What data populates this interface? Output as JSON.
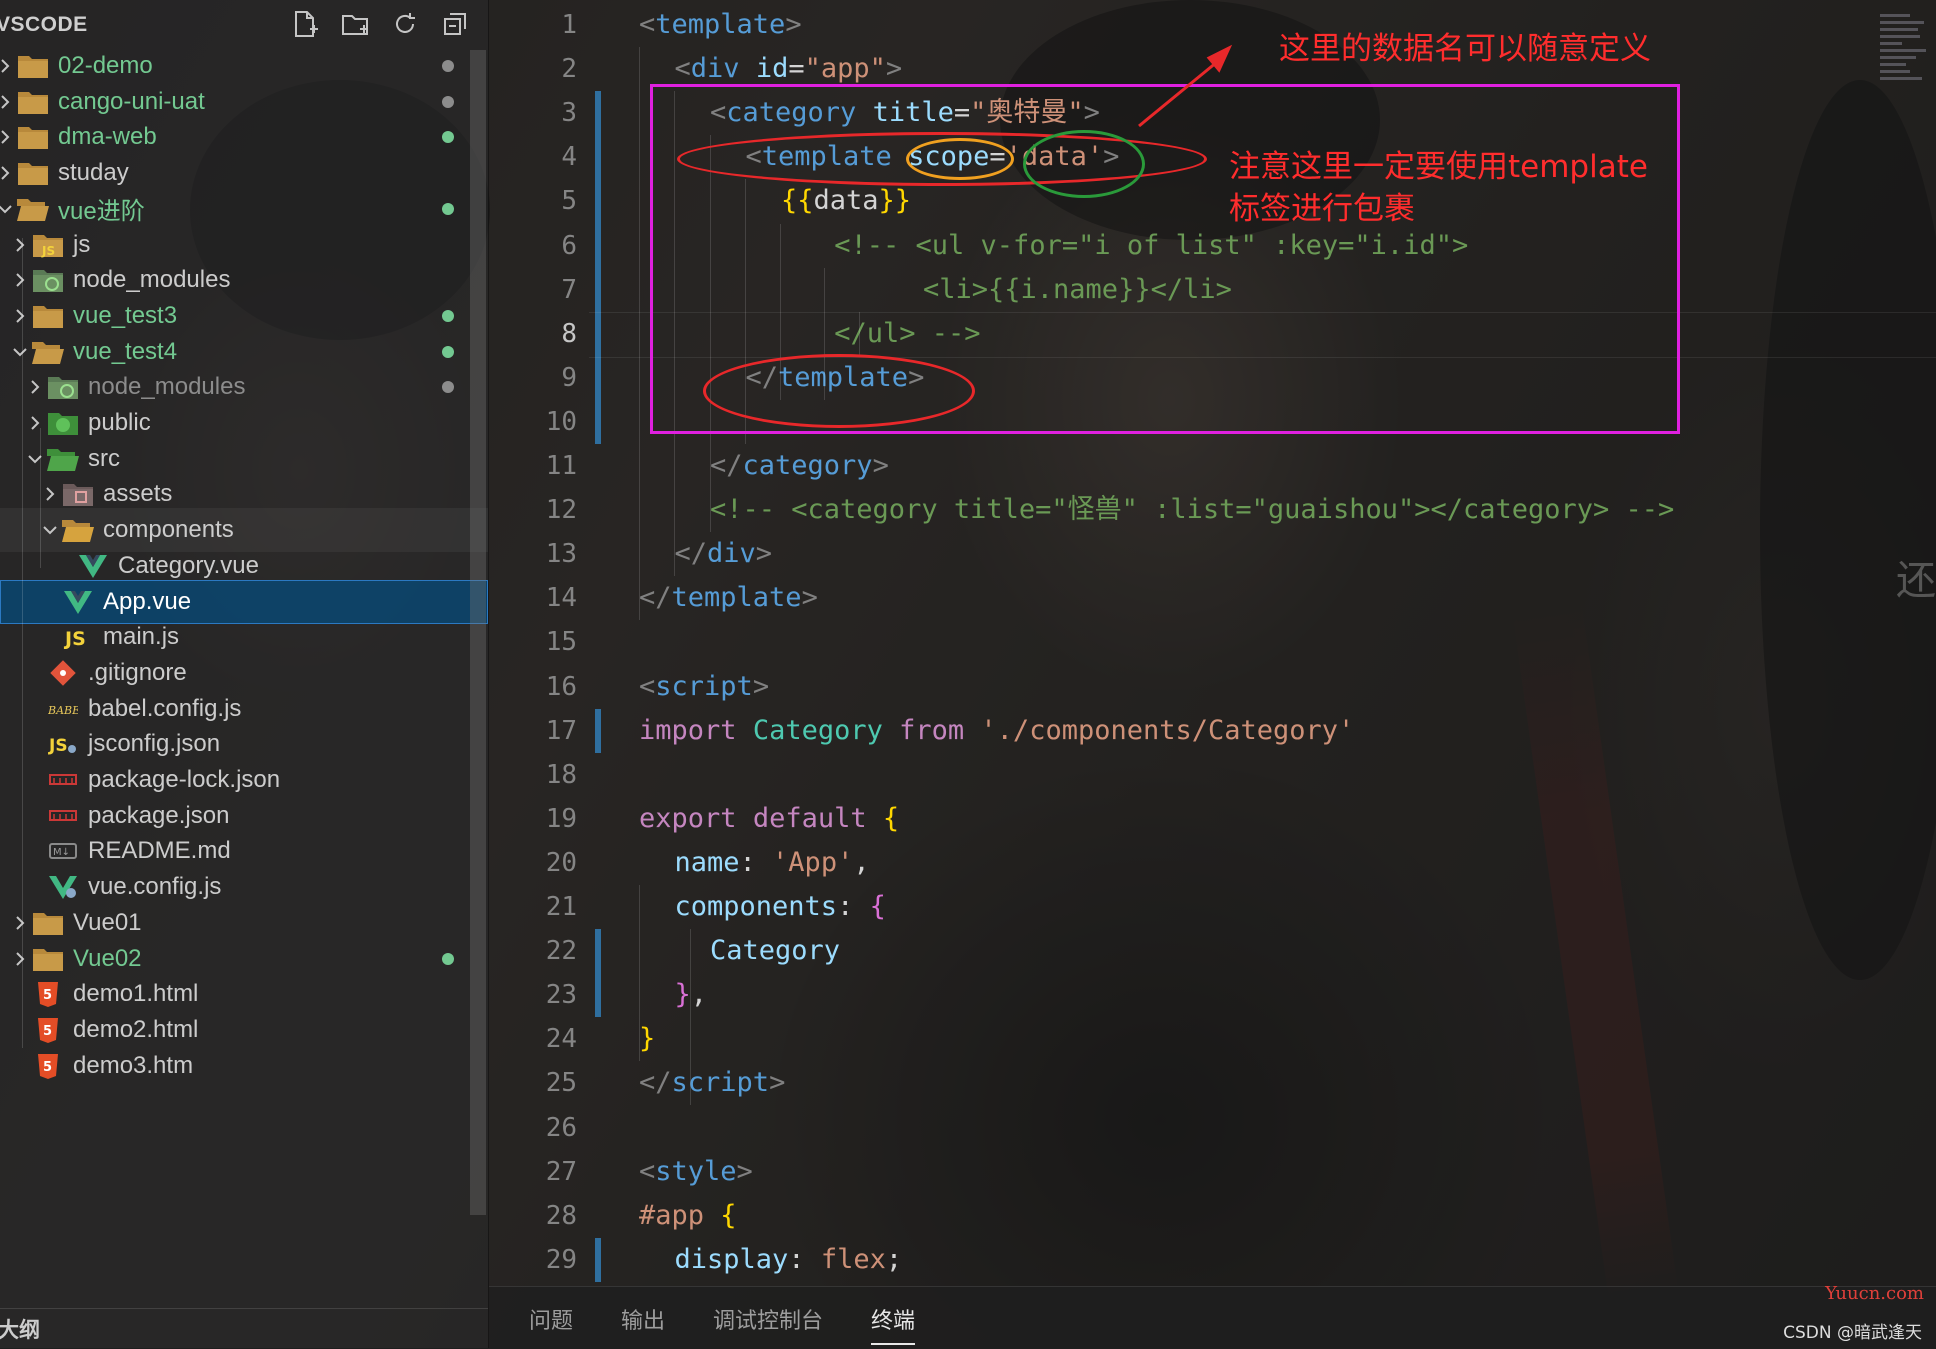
{
  "sidebar": {
    "title": "VSCODE",
    "actions": [
      "new-file-icon",
      "new-folder-icon",
      "refresh-icon",
      "collapse-all-icon"
    ],
    "outline_title": "大纲"
  },
  "tree": [
    {
      "label": "02-demo",
      "type": "folder",
      "depth": 0,
      "expanded": false,
      "color": "#73c991",
      "dot": "#8c8c8c"
    },
    {
      "label": "cango-uni-uat",
      "type": "folder",
      "depth": 0,
      "expanded": false,
      "color": "#73c991",
      "dot": "#8c8c8c"
    },
    {
      "label": "dma-web",
      "type": "folder",
      "depth": 0,
      "expanded": false,
      "color": "#73c991",
      "dot": "#73c991"
    },
    {
      "label": "studay",
      "type": "folder",
      "depth": 0,
      "expanded": false,
      "color": "#cccccc",
      "dot": ""
    },
    {
      "label": "vue进阶",
      "type": "folder-open",
      "depth": 0,
      "expanded": true,
      "color": "#73c991",
      "dot": "#73c991"
    },
    {
      "label": "js",
      "type": "folder-js",
      "depth": 1,
      "expanded": false,
      "color": "#cccccc",
      "dot": ""
    },
    {
      "label": "node_modules",
      "type": "folder-node",
      "depth": 1,
      "expanded": false,
      "color": "#cccccc",
      "dot": ""
    },
    {
      "label": "vue_test3",
      "type": "folder",
      "depth": 1,
      "expanded": false,
      "color": "#73c991",
      "dot": "#73c991"
    },
    {
      "label": "vue_test4",
      "type": "folder-open",
      "depth": 1,
      "expanded": true,
      "color": "#73c991",
      "dot": "#73c991"
    },
    {
      "label": "node_modules",
      "type": "folder-node",
      "depth": 2,
      "expanded": false,
      "color": "#8c8c8c",
      "dot": "#8c8c8c"
    },
    {
      "label": "public",
      "type": "folder-public",
      "depth": 2,
      "expanded": false,
      "color": "#cccccc",
      "dot": ""
    },
    {
      "label": "src",
      "type": "folder-src",
      "depth": 2,
      "expanded": true,
      "color": "#cccccc",
      "dot": ""
    },
    {
      "label": "assets",
      "type": "folder-assets",
      "depth": 3,
      "expanded": false,
      "color": "#cccccc",
      "dot": ""
    },
    {
      "label": "components",
      "type": "folder-components",
      "depth": 3,
      "expanded": true,
      "color": "#cccccc",
      "dot": "",
      "hover": true
    },
    {
      "label": "Category.vue",
      "type": "vue",
      "depth": 4,
      "color": "#cccccc",
      "dot": ""
    },
    {
      "label": "App.vue",
      "type": "vue",
      "depth": 3,
      "color": "#ffffff",
      "dot": "",
      "selected": true
    },
    {
      "label": "main.js",
      "type": "js",
      "depth": 3,
      "color": "#cccccc",
      "dot": ""
    },
    {
      "label": ".gitignore",
      "type": "git",
      "depth": 2,
      "color": "#cccccc",
      "dot": ""
    },
    {
      "label": "babel.config.js",
      "type": "babel",
      "depth": 2,
      "color": "#cccccc",
      "dot": ""
    },
    {
      "label": "jsconfig.json",
      "type": "jsconfig",
      "depth": 2,
      "color": "#cccccc",
      "dot": ""
    },
    {
      "label": "package-lock.json",
      "type": "npm",
      "depth": 2,
      "color": "#cccccc",
      "dot": ""
    },
    {
      "label": "package.json",
      "type": "npm",
      "depth": 2,
      "color": "#cccccc",
      "dot": ""
    },
    {
      "label": "README.md",
      "type": "md",
      "depth": 2,
      "color": "#cccccc",
      "dot": ""
    },
    {
      "label": "vue.config.js",
      "type": "vueconfig",
      "depth": 2,
      "color": "#cccccc",
      "dot": ""
    },
    {
      "label": "Vue01",
      "type": "folder",
      "depth": 1,
      "expanded": false,
      "color": "#cccccc",
      "dot": ""
    },
    {
      "label": "Vue02",
      "type": "folder",
      "depth": 1,
      "expanded": false,
      "color": "#73c991",
      "dot": "#73c991"
    },
    {
      "label": "demo1.html",
      "type": "html",
      "depth": 1,
      "color": "#cccccc",
      "dot": ""
    },
    {
      "label": "demo2.html",
      "type": "html",
      "depth": 1,
      "color": "#cccccc",
      "dot": ""
    },
    {
      "label": "demo3.htm",
      "type": "html",
      "depth": 1,
      "color": "#cccccc",
      "dot": ""
    }
  ],
  "editor": {
    "active_line": 8,
    "lines": [
      {
        "n": "1",
        "indent": 0,
        "tokens": [
          [
            "p",
            "<"
          ],
          [
            "t",
            "template"
          ],
          [
            "p",
            ">"
          ]
        ]
      },
      {
        "n": "2",
        "indent": 1,
        "tokens": [
          [
            "p",
            "<"
          ],
          [
            "t",
            "div"
          ],
          [
            "w",
            " "
          ],
          [
            "a",
            "id"
          ],
          [
            "w",
            "="
          ],
          [
            "s",
            "\"app\""
          ],
          [
            "p",
            ">"
          ]
        ]
      },
      {
        "n": "3",
        "indent": 2,
        "tokens": [
          [
            "p",
            "<"
          ],
          [
            "t",
            "category"
          ],
          [
            "w",
            " "
          ],
          [
            "a",
            "title"
          ],
          [
            "w",
            "="
          ],
          [
            "s",
            "\"奥特曼\""
          ],
          [
            "p",
            ">"
          ]
        ]
      },
      {
        "n": "4",
        "indent": 3,
        "tokens": [
          [
            "p",
            "<"
          ],
          [
            "t",
            "template"
          ],
          [
            "w",
            " "
          ],
          [
            "a",
            "scope"
          ],
          [
            "w",
            "="
          ],
          [
            "s",
            "'data'"
          ],
          [
            "p",
            ">"
          ]
        ]
      },
      {
        "n": "5",
        "indent": 4,
        "tokens": [
          [
            "y",
            "{{"
          ],
          [
            "w",
            "data"
          ],
          [
            "y",
            "}}"
          ]
        ]
      },
      {
        "n": "6",
        "indent": 5.5,
        "tokens": [
          [
            "c",
            "<!-- <ul v-for=\"i of list\" :key=\"i.id\">"
          ]
        ]
      },
      {
        "n": "7",
        "indent": 8,
        "tokens": [
          [
            "c",
            "<li>{{i.name}}</li>"
          ]
        ]
      },
      {
        "n": "8",
        "indent": 5.5,
        "tokens": [
          [
            "c",
            "</ul> -->"
          ]
        ]
      },
      {
        "n": "9",
        "indent": 3,
        "tokens": [
          [
            "p",
            "</"
          ],
          [
            "t",
            "template"
          ],
          [
            "p",
            ">"
          ]
        ]
      },
      {
        "n": "10",
        "indent": 0,
        "tokens": []
      },
      {
        "n": "11",
        "indent": 2,
        "tokens": [
          [
            "p",
            "</"
          ],
          [
            "t",
            "category"
          ],
          [
            "p",
            ">"
          ]
        ]
      },
      {
        "n": "12",
        "indent": 2,
        "tokens": [
          [
            "c",
            "<!-- <category title=\"怪兽\" :list=\"guaishou\"></category> -->"
          ]
        ]
      },
      {
        "n": "13",
        "indent": 1,
        "tokens": [
          [
            "p",
            "</"
          ],
          [
            "t",
            "div"
          ],
          [
            "p",
            ">"
          ]
        ]
      },
      {
        "n": "14",
        "indent": 0,
        "tokens": [
          [
            "p",
            "</"
          ],
          [
            "t",
            "template"
          ],
          [
            "p",
            ">"
          ]
        ]
      },
      {
        "n": "15",
        "indent": 0,
        "tokens": []
      },
      {
        "n": "16",
        "indent": 0,
        "tokens": [
          [
            "p",
            "<"
          ],
          [
            "t",
            "script"
          ],
          [
            "p",
            ">"
          ]
        ]
      },
      {
        "n": "17",
        "indent": 0,
        "tokens": [
          [
            "k",
            "import"
          ],
          [
            "w",
            " "
          ],
          [
            "cls",
            "Category"
          ],
          [
            "w",
            " "
          ],
          [
            "k",
            "from"
          ],
          [
            "w",
            " "
          ],
          [
            "s",
            "'./components/Category'"
          ]
        ]
      },
      {
        "n": "18",
        "indent": 0,
        "tokens": []
      },
      {
        "n": "19",
        "indent": 0,
        "tokens": [
          [
            "k",
            "export"
          ],
          [
            "w",
            " "
          ],
          [
            "k",
            "default"
          ],
          [
            "w",
            " "
          ],
          [
            "y",
            "{"
          ]
        ]
      },
      {
        "n": "20",
        "indent": 1,
        "tokens": [
          [
            "v",
            "name"
          ],
          [
            "w",
            ": "
          ],
          [
            "s",
            "'App'"
          ],
          [
            "w",
            ","
          ]
        ]
      },
      {
        "n": "21",
        "indent": 1,
        "tokens": [
          [
            "v",
            "components"
          ],
          [
            "w",
            ": "
          ],
          [
            "m",
            "{"
          ]
        ]
      },
      {
        "n": "22",
        "indent": 2,
        "tokens": [
          [
            "v",
            "Category"
          ]
        ]
      },
      {
        "n": "23",
        "indent": 1,
        "tokens": [
          [
            "m",
            "}"
          ],
          [
            "w",
            ","
          ]
        ]
      },
      {
        "n": "24",
        "indent": 0,
        "tokens": [
          [
            "y",
            "}"
          ]
        ]
      },
      {
        "n": "25",
        "indent": 0,
        "tokens": [
          [
            "p",
            "</"
          ],
          [
            "t",
            "script"
          ],
          [
            "p",
            ">"
          ]
        ]
      },
      {
        "n": "26",
        "indent": 0,
        "tokens": []
      },
      {
        "n": "27",
        "indent": 0,
        "tokens": [
          [
            "p",
            "<"
          ],
          [
            "t",
            "style"
          ],
          [
            "p",
            ">"
          ]
        ]
      },
      {
        "n": "28",
        "indent": 0,
        "tokens": [
          [
            "s",
            "#app"
          ],
          [
            "w",
            " "
          ],
          [
            "y",
            "{"
          ]
        ]
      },
      {
        "n": "29",
        "indent": 1,
        "tokens": [
          [
            "v",
            "display"
          ],
          [
            "w",
            ": "
          ],
          [
            "s",
            "flex"
          ],
          [
            "w",
            ";"
          ]
        ]
      }
    ]
  },
  "annotations": {
    "note_top": "这里的数据名可以随意定义",
    "note_side_1": "注意这里一定要使用template",
    "note_side_2": "标签进行包裹",
    "colors": {
      "box": "#e020e0",
      "ellipse": "#e8282a",
      "text": "#ff2d2d"
    }
  },
  "panel": {
    "tabs": [
      {
        "label": "问题",
        "active": false
      },
      {
        "label": "输出",
        "active": false
      },
      {
        "label": "调试控制台",
        "active": false
      },
      {
        "label": "终端",
        "active": true
      }
    ],
    "watermark": "CSDN @暗武逢天",
    "watermark_site": "Yuucn.com",
    "edge_char": "还"
  }
}
